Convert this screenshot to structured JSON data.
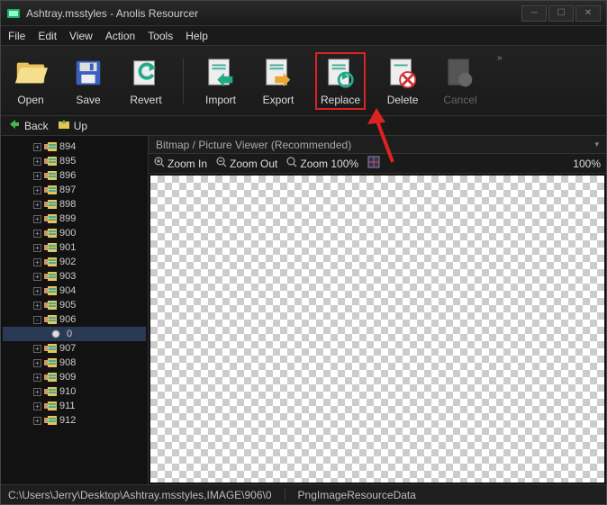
{
  "title": "Ashtray.msstyles - Anolis Resourcer",
  "menus": [
    "File",
    "Edit",
    "View",
    "Action",
    "Tools",
    "Help"
  ],
  "toolbar": {
    "open": "Open",
    "save": "Save",
    "revert": "Revert",
    "import": "Import",
    "export": "Export",
    "replace": "Replace",
    "delete": "Delete",
    "cancel": "Cancel"
  },
  "nav": {
    "back": "Back",
    "up": "Up"
  },
  "tree": {
    "items": [
      {
        "id": "894",
        "expanded": false
      },
      {
        "id": "895",
        "expanded": false
      },
      {
        "id": "896",
        "expanded": false
      },
      {
        "id": "897",
        "expanded": false
      },
      {
        "id": "898",
        "expanded": false
      },
      {
        "id": "899",
        "expanded": false
      },
      {
        "id": "900",
        "expanded": false
      },
      {
        "id": "901",
        "expanded": false
      },
      {
        "id": "902",
        "expanded": false
      },
      {
        "id": "903",
        "expanded": false
      },
      {
        "id": "904",
        "expanded": false
      },
      {
        "id": "905",
        "expanded": false
      },
      {
        "id": "906",
        "expanded": true,
        "children": [
          {
            "id": "0",
            "selected": true
          }
        ]
      },
      {
        "id": "907",
        "expanded": false
      },
      {
        "id": "908",
        "expanded": false
      },
      {
        "id": "909",
        "expanded": false
      },
      {
        "id": "910",
        "expanded": false
      },
      {
        "id": "911",
        "expanded": false
      },
      {
        "id": "912",
        "expanded": false
      }
    ]
  },
  "viewer": {
    "header": "Bitmap / Picture Viewer (Recommended)",
    "zoom_in": "Zoom In",
    "zoom_out": "Zoom Out",
    "zoom_100": "Zoom 100%",
    "zoom_value": "100%"
  },
  "status": {
    "path": "C:\\Users\\Jerry\\Desktop\\Ashtray.msstyles,IMAGE\\906\\0",
    "type": "PngImageResourceData"
  }
}
